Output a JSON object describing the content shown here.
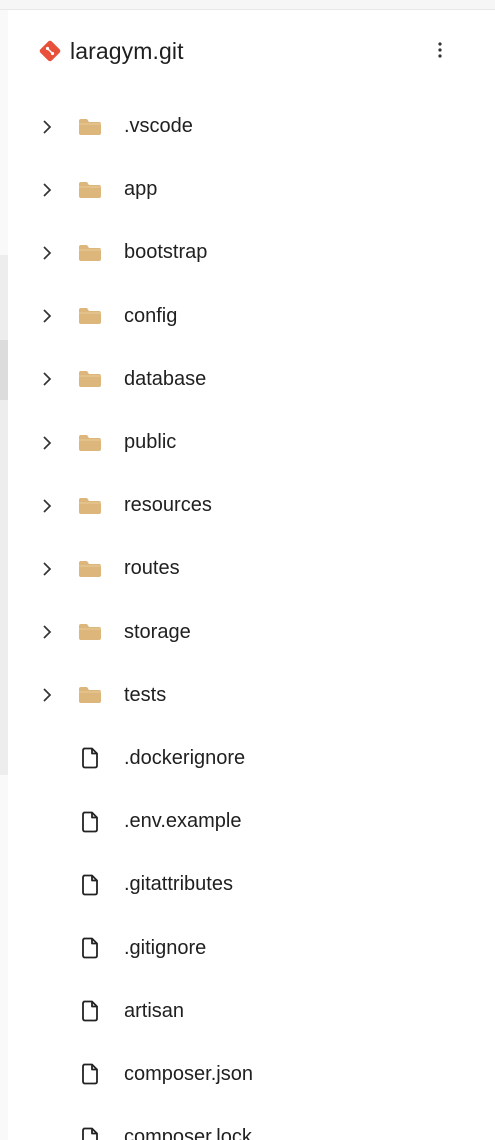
{
  "repo": {
    "name": "laragym.git",
    "icon": "git-diamond-icon",
    "menu_icon": "more-vertical-icon",
    "accent": "#e8503a"
  },
  "tree": {
    "folder_color": "#dcb67a",
    "folders": [
      {
        "label": ".vscode"
      },
      {
        "label": "app"
      },
      {
        "label": "bootstrap"
      },
      {
        "label": "config"
      },
      {
        "label": "database"
      },
      {
        "label": "public"
      },
      {
        "label": "resources"
      },
      {
        "label": "routes"
      },
      {
        "label": "storage"
      },
      {
        "label": "tests"
      }
    ],
    "files": [
      {
        "label": ".dockerignore"
      },
      {
        "label": ".env.example"
      },
      {
        "label": ".gitattributes"
      },
      {
        "label": ".gitignore"
      },
      {
        "label": "artisan"
      },
      {
        "label": "composer.json"
      },
      {
        "label": "composer.lock"
      }
    ]
  }
}
